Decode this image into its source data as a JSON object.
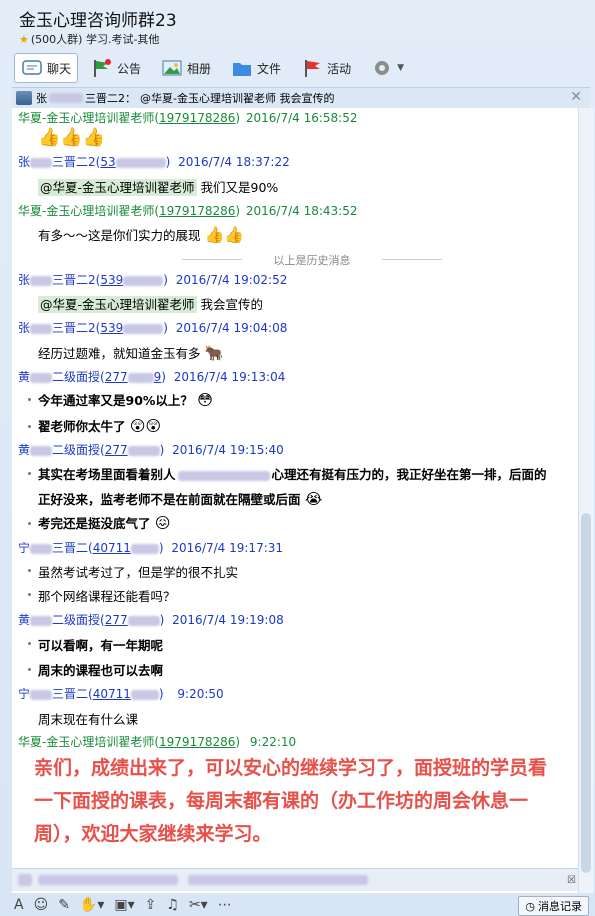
{
  "window": {
    "title": "金玉心理咨询师群23",
    "subtitle": "(500人群) 学习.考试-其他"
  },
  "toolbar": {
    "tabs": [
      {
        "label": "聊天"
      },
      {
        "label": "公告"
      },
      {
        "label": "相册"
      },
      {
        "label": "文件"
      },
      {
        "label": "活动"
      }
    ]
  },
  "notice": {
    "sender": "张",
    "sender_tail": "三晋二2：",
    "text": "@华夏-金玉心理培训翟老师 我会宣传的"
  },
  "history_divider": "以上是历史消息",
  "messages": [
    {
      "name": "华夏-金玉心理培训翟老师",
      "qq": "1979178286",
      "time": "2016/7/4 16:58:52"
    },
    {
      "name_a": "张",
      "name_b": "三晋二2",
      "qq_a": "53",
      "qq_b": "",
      "time": "2016/7/4 18:37:22",
      "mention": "@华夏-金玉心理培训翟老师",
      "text": "我们又是90%"
    },
    {
      "name": "华夏-金玉心理培训翟老师",
      "qq": "1979178286",
      "time": "2016/7/4 18:43:52",
      "text": "有多～～这是你们实力的展现"
    },
    {
      "name_a": "张",
      "name_b": "三晋二2",
      "qq_a": "539",
      "time": "2016/7/4 19:02:52",
      "mention": "@华夏-金玉心理培训翟老师",
      "text": "我会宣传的"
    },
    {
      "name_a": "张",
      "name_b": "三晋二2",
      "qq_a": "539",
      "time": "2016/7/4 19:04:08",
      "text": "经历过题难，就知道金玉有多"
    },
    {
      "name_a": "黄",
      "name_b": "二级面授",
      "qq_a": "277",
      "qq_b": "9",
      "time": "2016/7/4 19:13:04",
      "lines": [
        "今年通过率又是90%以上？",
        "翟老师你太牛了"
      ]
    },
    {
      "name_a": "黄",
      "name_b": "二级面授",
      "qq_a": "277",
      "time": "2016/7/4 19:15:40",
      "lines": [
        "其实在考场里面看着别人",
        "心理还有挺有压力的，我正好坐在第一排，后面的",
        "正好没来，监考老师不是在前面就在隔壁或后面",
        "考完还是挺没底气了"
      ]
    },
    {
      "name_a": "宁",
      "name_b": "三晋二",
      "qq_a": "40711",
      "time": "2016/7/4 19:17:31",
      "lines": [
        "虽然考试考过了，但是学的很不扎实",
        "那个网络课程还能看吗？"
      ]
    },
    {
      "name_a": "黄",
      "name_b": "二级面授",
      "qq_a": "277",
      "time": "2016/7/4 19:19:08",
      "lines": [
        "可以看啊，有一年期呢",
        "周末的课程也可以去啊"
      ]
    },
    {
      "name_a": "宁",
      "name_b": "三晋二",
      "qq_a": "40711",
      "time": "9:20:50",
      "text": "周末现在有什么课"
    },
    {
      "name": "华夏-金玉心理培训翟老师",
      "qq": "1979178286",
      "time": "9:22:10",
      "big": "亲们，成绩出来了，可以安心的继续学习了，面授班的学员看一下面授的课表，每周末都有课的（办工作坊的周会休息一周），欢迎大家继续来学习。"
    }
  ],
  "bottom": {
    "record_label": "消息记录"
  },
  "colors": {
    "green_name": "#178a3a",
    "blue_name": "#1b39c9",
    "announcement_red": "#e8504a"
  }
}
